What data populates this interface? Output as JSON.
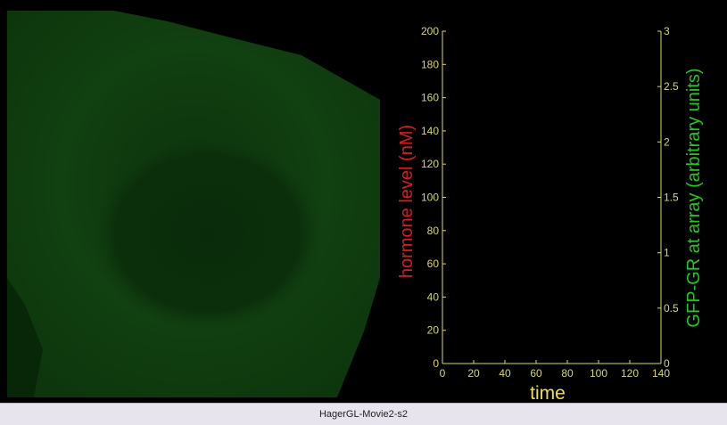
{
  "caption": "HagerGL-Movie2-s2",
  "chart_data": {
    "type": "line",
    "xlabel": "time",
    "ylabel_left": "hormone level (nM)",
    "ylabel_right": "GFP-GR at array (arbitrary units)",
    "xlim": [
      0,
      140
    ],
    "ylim_left": [
      0,
      200
    ],
    "ylim_right": [
      0,
      3
    ],
    "x_ticks": [
      "0",
      "20",
      "40",
      "60",
      "80",
      "100",
      "120",
      "140"
    ],
    "y_left_ticks": [
      "0",
      "20",
      "40",
      "60",
      "80",
      "100",
      "120",
      "140",
      "160",
      "180",
      "200"
    ],
    "y_right_ticks": [
      "0",
      "0.5",
      "1",
      "1.5",
      "2",
      "2.5",
      "3"
    ],
    "series": [],
    "grid": false,
    "colors": {
      "axes": "#d8d86a",
      "ylabel_left": "#d81e1e",
      "ylabel_right": "#22c81e",
      "xlabel": "#f0e040",
      "cell": "#0f3d0f"
    }
  }
}
